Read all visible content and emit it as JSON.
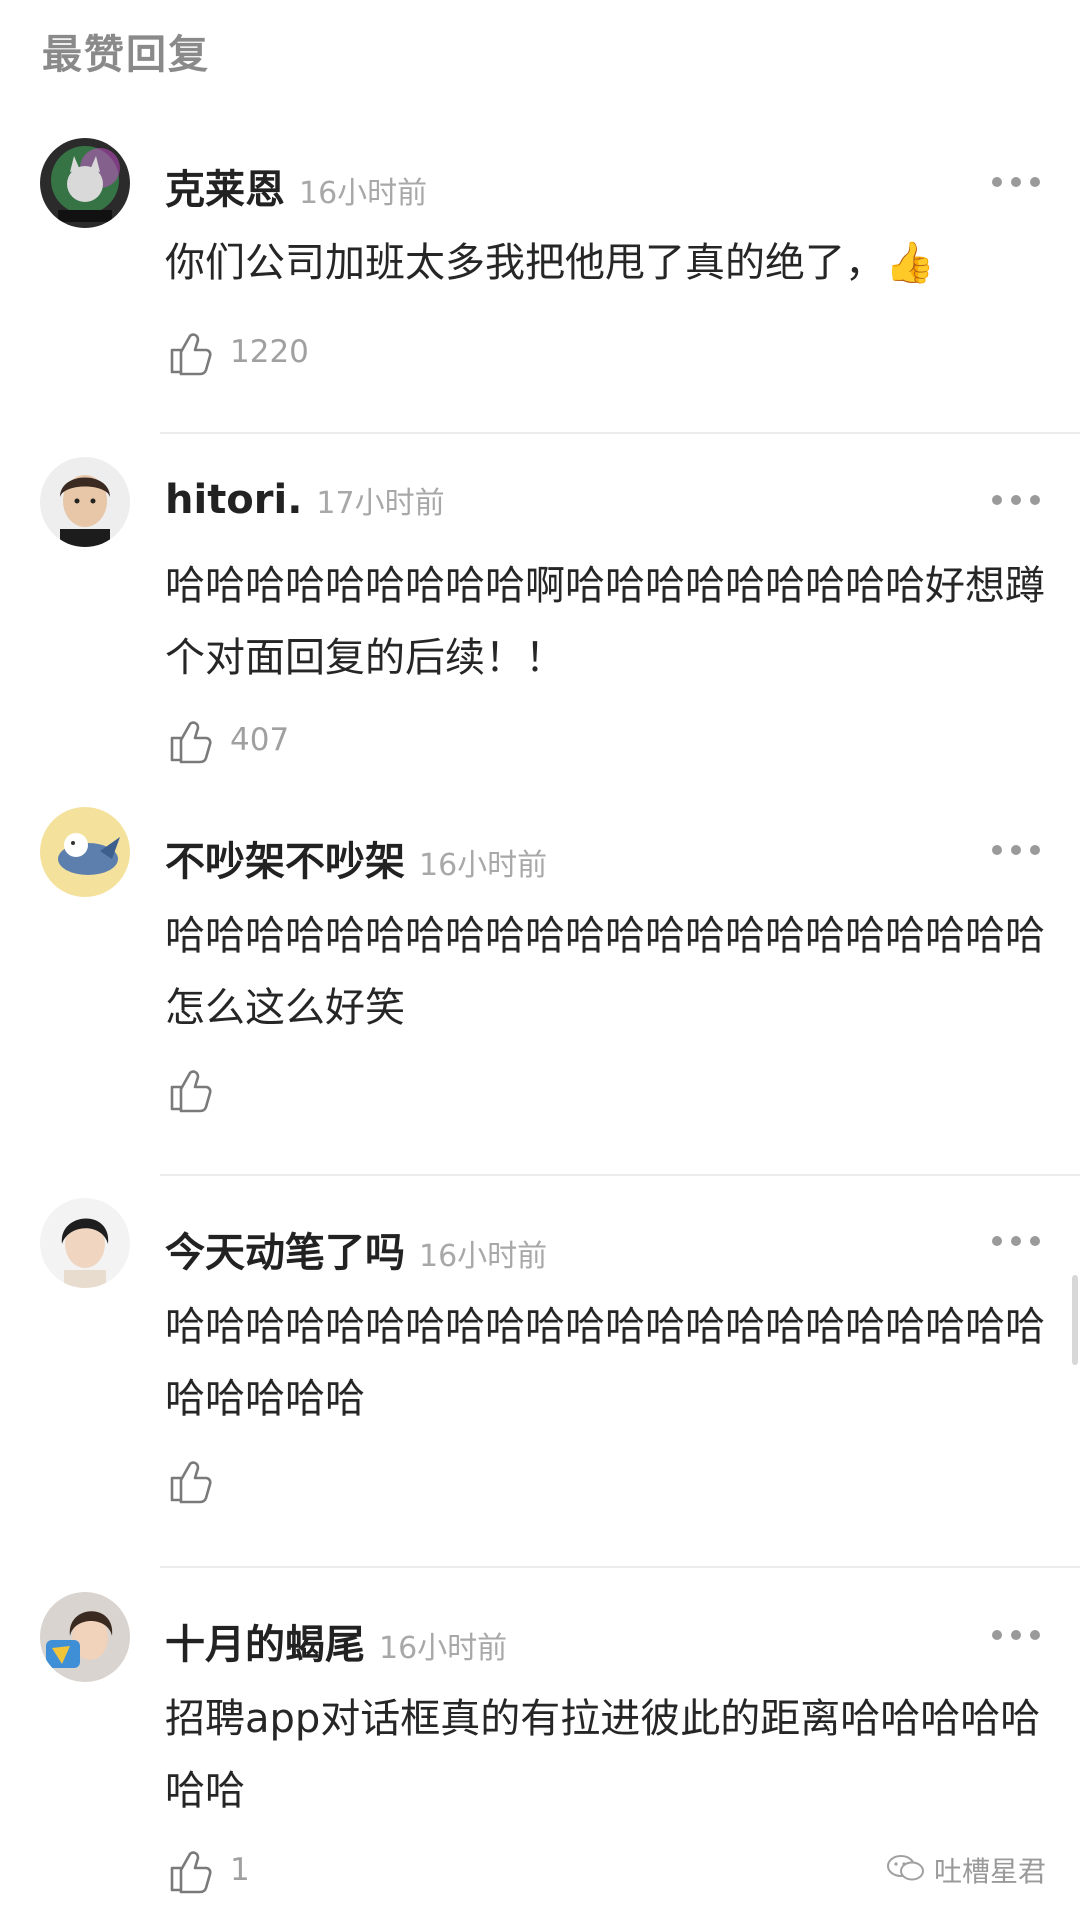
{
  "section_title": "最赞回复",
  "comments": [
    {
      "username": "克莱恩",
      "time": "16小时前",
      "text": "你们公司加班太多我把他甩了真的绝了，",
      "emoji": "👍",
      "likes": "1220"
    },
    {
      "username": "hitori.",
      "time": "17小时前",
      "text": "哈哈哈哈哈哈哈哈哈啊哈哈哈哈哈哈哈哈哈好想蹲个对面回复的后续！！",
      "likes": "407"
    },
    {
      "username": "不吵架不吵架",
      "time": "16小时前",
      "text": "哈哈哈哈哈哈哈哈哈哈哈哈哈哈哈哈哈哈哈哈哈哈怎么这么好笑",
      "likes": ""
    },
    {
      "username": "今天动笔了吗",
      "time": "16小时前",
      "text": "哈哈哈哈哈哈哈哈哈哈哈哈哈哈哈哈哈哈哈哈哈哈哈哈哈哈哈",
      "likes": ""
    },
    {
      "username": "十月的蝎尾",
      "time": "16小时前",
      "text": "招聘app对话框真的有拉进彼此的距离哈哈哈哈哈哈哈",
      "likes": "1"
    }
  ],
  "watermark": "吐槽星君",
  "icons": {
    "like": "thumbs-up-outline-icon",
    "more": "more-dots-icon",
    "watermark": "wechat-icon"
  },
  "colors": {
    "username": "#222222",
    "meta": "#a8a8a8",
    "text": "#262626",
    "divider": "#ececec"
  }
}
